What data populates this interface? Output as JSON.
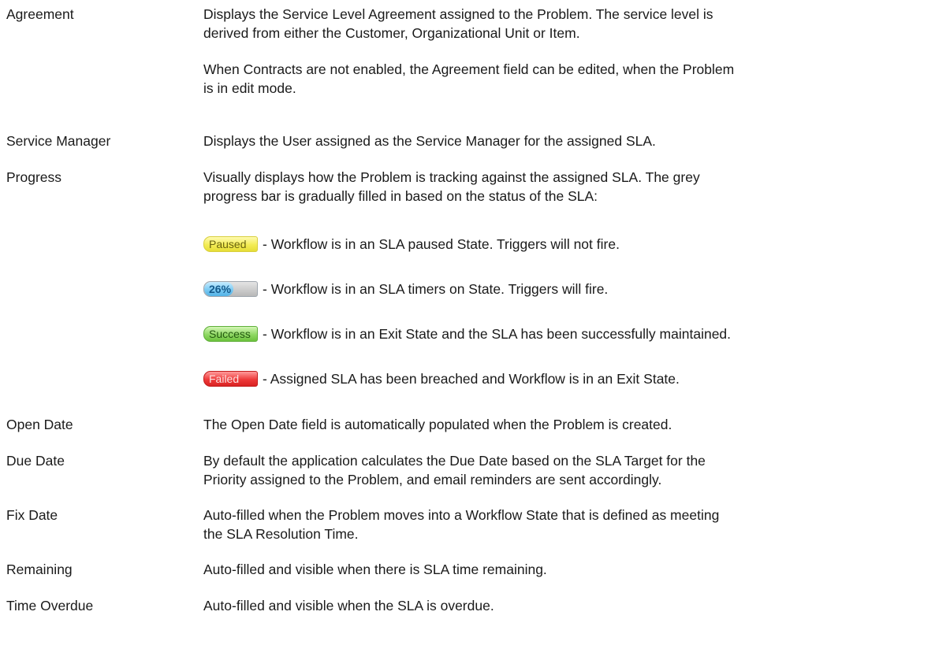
{
  "rows": {
    "agreement": {
      "term": "Agreement",
      "p1": [
        "Displays the Service Level Agreement assigned to the Problem. The service level is",
        "derived from either the Customer, Organizational Unit or Item."
      ],
      "p2": [
        "When Contracts are not enabled, the Agreement field can be edited, when the Problem",
        "is in edit mode."
      ]
    },
    "service_manager": {
      "term": "Service Manager",
      "p1": [
        "Displays the User assigned as the Service Manager for the assigned SLA."
      ]
    },
    "progress": {
      "term": "Progress",
      "p1": [
        "Visually displays how the Problem is tracking against the assigned SLA. The grey",
        "progress bar is gradually filled in based on the status of the SLA:"
      ],
      "statuses": {
        "paused": {
          "badge": "Paused",
          "text": "- Workflow is in an SLA paused State. Triggers will not fire."
        },
        "timers_on": {
          "badge": "26%",
          "progress": 0.26,
          "text": "- Workflow is in an SLA timers on State. Triggers will fire."
        },
        "success": {
          "badge": "Success",
          "text": "- Workflow is in an Exit State and the SLA has been successfully maintained."
        },
        "failed": {
          "badge": "Failed",
          "text": "- Assigned SLA has been breached and Workflow is in an Exit State."
        }
      }
    },
    "open_date": {
      "term": "Open Date",
      "p1": [
        "The Open Date field is automatically populated when the Problem is created."
      ]
    },
    "due_date": {
      "term": "Due Date",
      "p1": [
        "By default the application calculates the Due Date based on the SLA Target for the",
        "Priority assigned to the Problem, and email reminders are sent accordingly."
      ]
    },
    "fix_date": {
      "term": "Fix Date",
      "p1": [
        "Auto-filled when the Problem moves into a Workflow State that is defined as meeting",
        "the SLA Resolution Time."
      ]
    },
    "remaining": {
      "term": "Remaining",
      "p1": [
        "Auto-filled and visible when there is SLA time remaining."
      ]
    },
    "time_overdue": {
      "term": "Time Overdue",
      "p1": [
        "Auto-filled and visible when the SLA is overdue."
      ]
    }
  },
  "colors": {
    "text": "#1a1a1a",
    "paused": "#f3ec55",
    "timers_on": "#7ccaf3",
    "track": "#b8b8b8",
    "success": "#8fd764",
    "failed": "#ee3a3a"
  }
}
